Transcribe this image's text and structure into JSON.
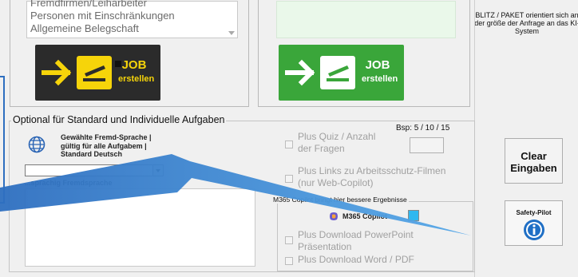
{
  "audience_list": [
    "Fremdfirmen/Leiharbeiter",
    "Personen mit Einschränkungen",
    "Allgemeine Belegschaft"
  ],
  "job_button_1": {
    "line1": "JOB",
    "line2": "erstellen"
  },
  "job_button_2": {
    "line1": "JOB",
    "line2": "erstellen"
  },
  "blitz_note": "BLITZ / PAKET orientiert sich an der größe der Anfrage an das KI-System",
  "optional_section": {
    "title": "Optional für Standard und Individuelle Aufgaben",
    "language_info": [
      "Gewählte Fremd-Sprache |",
      "gültig für alle Aufgabem |",
      "Standard Deutsch"
    ],
    "language_select_value": "",
    "language_caption": "...sprachig Fremdsprache",
    "bsp_label": "Bsp: 5 / 10 / 15",
    "quiz_label": [
      "Plus Quiz / Anzahl",
      "der Fragen"
    ],
    "links_label": [
      "Plus Links zu Arbeitsschutz-Filmen",
      "(nur Web-Copilot)"
    ],
    "m365_group_label": "M365 Copilot bringt hier bessere Ergebnisse",
    "m365_copilot_label": "M365 Copilot",
    "ppt_label": [
      "Plus Download PowerPoint",
      "Präsentation"
    ],
    "word_label": "Plus Download Word / PDF"
  },
  "clear_button": [
    "Clear",
    "Eingaben"
  ],
  "safety_pilot_label": "Safety-Pilot",
  "colors": {
    "job_yellow": "#f6d40a",
    "job_dark": "#2b2b2b",
    "job_green": "#3aa63a",
    "arrow_blue": "#2e8fd6"
  }
}
